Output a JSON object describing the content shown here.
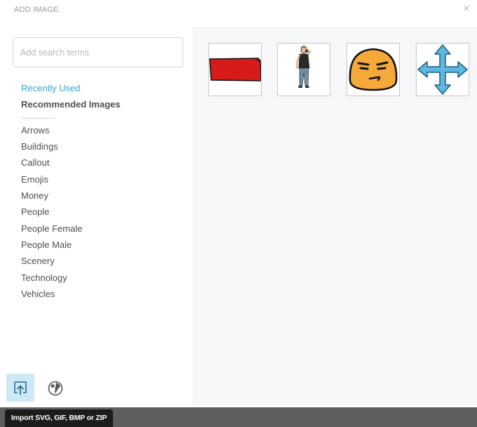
{
  "dialog": {
    "title": "ADD IMAGE",
    "close_glyph": "×"
  },
  "search": {
    "placeholder": "Add search terms",
    "value": ""
  },
  "nav": {
    "recently_used": "Recently Used",
    "recommended": "Recommended Images"
  },
  "categories": [
    "Arrows",
    "Buildings",
    "Callout",
    "Emojis",
    "Money",
    "People",
    "People Female",
    "People Male",
    "Scenery",
    "Technology",
    "Vehicles"
  ],
  "thumbnails": [
    {
      "icon": "red-banner-icon"
    },
    {
      "icon": "person-on-phone-icon"
    },
    {
      "icon": "annoyed-face-emoji-icon"
    },
    {
      "icon": "four-way-arrow-icon"
    }
  ],
  "footer": {
    "upload_icon": "upload-icon",
    "globe_icon": "globe-icon",
    "tooltip": "Import SVG, GIF, BMP or ZIP"
  },
  "colors": {
    "accent": "#3aa3d4",
    "upload_bg": "#cfe9f4",
    "footer_bg": "#5e5e5e",
    "content_bg": "#f6f7f9"
  }
}
